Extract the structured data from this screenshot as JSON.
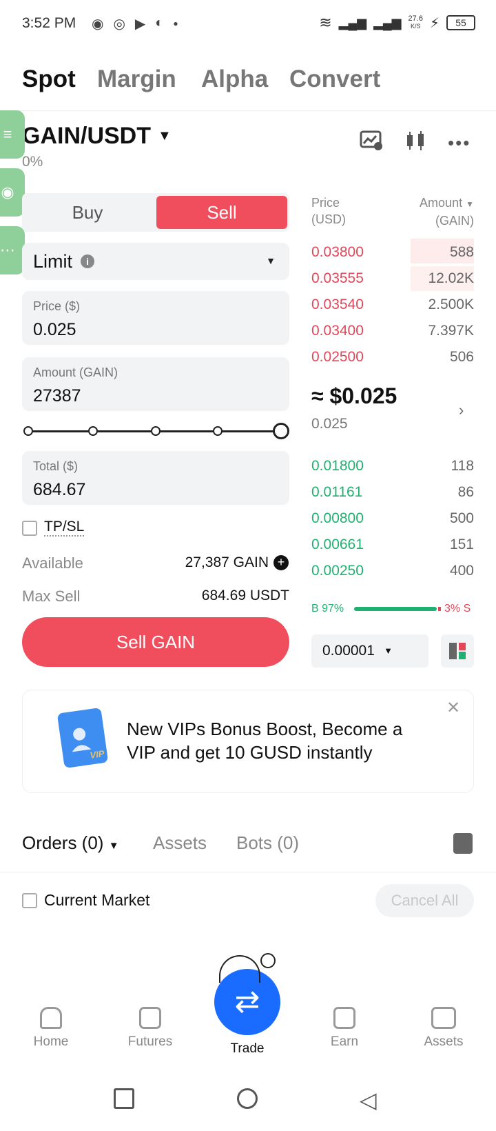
{
  "status_bar": {
    "time": "3:52 PM",
    "speed": "27.6",
    "speed_unit": "K/S",
    "battery": "55"
  },
  "top_tabs": [
    "Spot",
    "Margin",
    "Alpha",
    "Convert"
  ],
  "pair": {
    "name": "GAIN/USDT",
    "change": "0%"
  },
  "trade_form": {
    "buy_label": "Buy",
    "sell_label": "Sell",
    "order_type": "Limit",
    "price_label": "Price ($)",
    "price_value": "0.025",
    "amount_label": "Amount (GAIN)",
    "amount_value": "27387",
    "slider_level": 1.0,
    "total_label": "Total ($)",
    "total_value": "684.67",
    "tpsl_label": "TP/SL",
    "available_label": "Available",
    "available_value": "27,387 GAIN",
    "max_sell_label": "Max Sell",
    "max_sell_value": "684.69 USDT",
    "submit_label": "Sell GAIN"
  },
  "orderbook": {
    "price_header": "Price",
    "price_unit": "(USD)",
    "amount_header": "Amount",
    "amount_unit": "(GAIN)",
    "asks": [
      {
        "price": "0.03800",
        "amount": "588"
      },
      {
        "price": "0.03555",
        "amount": "12.02K"
      },
      {
        "price": "0.03540",
        "amount": "2.500K"
      },
      {
        "price": "0.03400",
        "amount": "7.397K"
      },
      {
        "price": "0.02500",
        "amount": "506"
      }
    ],
    "mid_price": "≈ $0.025",
    "mid_sub": "0.025",
    "bids": [
      {
        "price": "0.01800",
        "amount": "118"
      },
      {
        "price": "0.01161",
        "amount": "86"
      },
      {
        "price": "0.00800",
        "amount": "500"
      },
      {
        "price": "0.00661",
        "amount": "151"
      },
      {
        "price": "0.00250",
        "amount": "400"
      }
    ],
    "buy_ratio": "B 97%",
    "sell_ratio": "3% S",
    "precision": "0.00001"
  },
  "banner": {
    "text": "New VIPs Bonus Boost, Become a VIP and get 10 GUSD instantly",
    "badge": "VIP"
  },
  "orders_tabs": [
    "Orders (0)",
    "Assets",
    "Bots (0)"
  ],
  "current_market_label": "Current Market",
  "cancel_all_label": "Cancel All",
  "bottom_nav": [
    "Home",
    "Futures",
    "Trade",
    "Earn",
    "Assets"
  ],
  "colors": {
    "sell": "#f04e5d",
    "buy": "#22b071",
    "trade": "#1a6bff"
  }
}
